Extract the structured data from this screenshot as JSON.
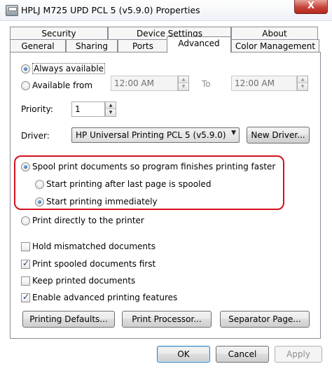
{
  "window": {
    "title": "HPLJ M725 UPD PCL 5 (v5.9.0) Properties",
    "close_label": "X"
  },
  "tabs": {
    "row1": [
      "Security",
      "Device Settings",
      "About"
    ],
    "row2": [
      "General",
      "Sharing",
      "Ports",
      "Advanced",
      "Color Management"
    ],
    "active": "Advanced"
  },
  "availability": {
    "always_label": "Always available",
    "from_label": "Available from",
    "from_time": "12:00 AM",
    "to_label": "To",
    "to_time": "12:00 AM",
    "selected": "always"
  },
  "priority": {
    "label": "Priority:",
    "value": "1"
  },
  "driver": {
    "label": "Driver:",
    "selected": "HP Universal Printing PCL 5 (v5.9.0)",
    "new_driver_label": "New Driver..."
  },
  "spooling": {
    "spool_label": "Spool print documents so program finishes printing faster",
    "after_last_page_label": "Start printing after last page is spooled",
    "immediately_label": "Start printing immediately",
    "direct_label": "Print directly to the printer",
    "selected_mode": "spool",
    "selected_start": "immediately"
  },
  "options": [
    {
      "label": "Hold mismatched documents",
      "checked": false
    },
    {
      "label": "Print spooled documents first",
      "checked": true
    },
    {
      "label": "Keep printed documents",
      "checked": false
    },
    {
      "label": "Enable advanced printing features",
      "checked": true
    }
  ],
  "buttons": {
    "printing_defaults": "Printing Defaults...",
    "print_processor": "Print Processor...",
    "separator_page": "Separator Page...",
    "ok": "OK",
    "cancel": "Cancel",
    "apply": "Apply"
  },
  "colors": {
    "highlight_outline": "#d3121c",
    "close_button": "#c7443a"
  }
}
